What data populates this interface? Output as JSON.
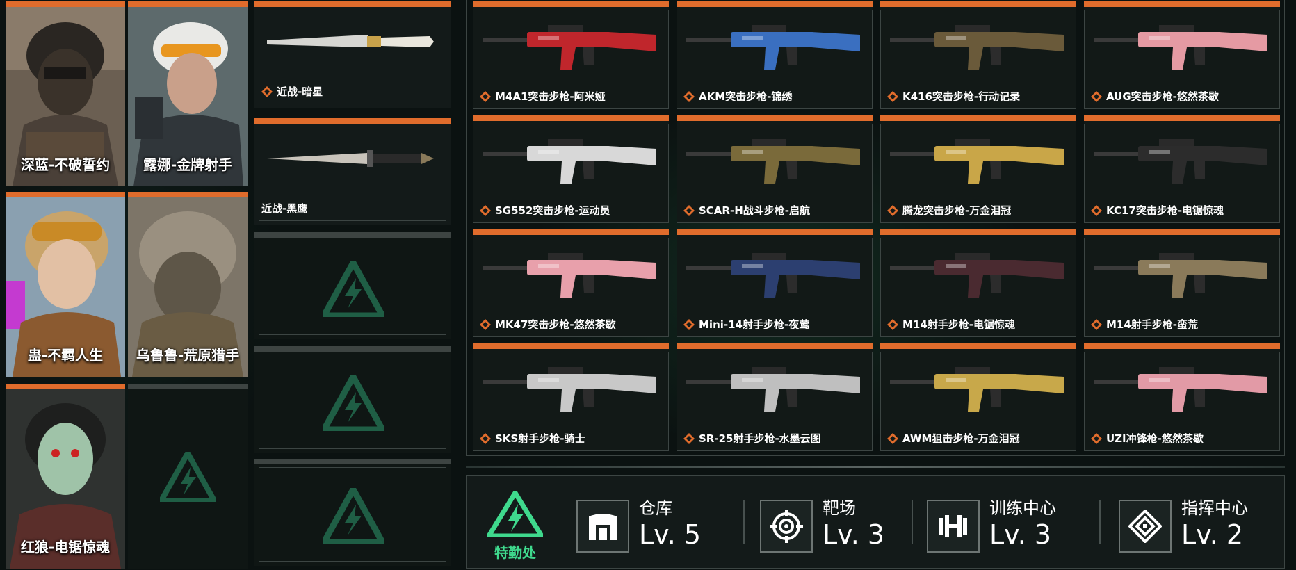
{
  "colors": {
    "accent_orange": "#e06c2c",
    "agency_green": "#3fd98d",
    "slot_empty_green": "#1f5e45"
  },
  "operators": [
    {
      "name": "深蓝-不破誓约",
      "empty": false,
      "icon": "operator-portrait-helmet"
    },
    {
      "name": "露娜-金牌射手",
      "empty": false,
      "icon": "operator-portrait-goggles-cap"
    },
    {
      "name": "蛊-不羁人生",
      "empty": false,
      "icon": "operator-portrait-goggles-blonde"
    },
    {
      "name": "乌鲁鲁-荒原猎手",
      "empty": false,
      "icon": "operator-portrait-ghillie"
    },
    {
      "name": "红狼-电锯惊魂",
      "empty": false,
      "icon": "operator-portrait-puppet-mask"
    },
    {
      "name": "",
      "empty": true,
      "icon": "empty-slot-logo-icon"
    }
  ],
  "melee": [
    {
      "label": "近战-暗星",
      "empty": false,
      "icon": "knife-icon"
    },
    {
      "label": "近战-黑鹰",
      "empty": false,
      "icon": "dagger-icon"
    },
    {
      "label": "",
      "empty": true
    },
    {
      "label": "",
      "empty": true
    },
    {
      "label": "",
      "empty": true
    }
  ],
  "weapons": [
    {
      "label": "M4A1突击步枪-阿米娅",
      "skin": "#c0262c"
    },
    {
      "label": "AKM突击步枪-锦绣",
      "skin": "#3a6fc0"
    },
    {
      "label": "K416突击步枪-行动记录",
      "skin": "#6a5a3a"
    },
    {
      "label": "AUG突击步枪-悠然茶歇",
      "skin": "#e59aa3"
    },
    {
      "label": "SG552突击步枪-运动员",
      "skin": "#d8d8d8"
    },
    {
      "label": "SCAR-H战斗步枪-启航",
      "skin": "#7a6a3a"
    },
    {
      "label": "腾龙突击步枪-万金泪冠",
      "skin": "#c9a648"
    },
    {
      "label": "KC17突击步枪-电锯惊魂",
      "skin": "#2c2c2c"
    },
    {
      "label": "MK47突击步枪-悠然茶歇",
      "skin": "#e8a0ab"
    },
    {
      "label": "Mini-14射手步枪-夜莺",
      "skin": "#2c3f70"
    },
    {
      "label": "M14射手步枪-电锯惊魂",
      "skin": "#4a2a30"
    },
    {
      "label": "M14射手步枪-蛮荒",
      "skin": "#8a7a5a"
    },
    {
      "label": "SKS射手步枪-骑士",
      "skin": "#c8c8c8"
    },
    {
      "label": "SR-25射手步枪-水墨云图",
      "skin": "#bfbfbf"
    },
    {
      "label": "AWM狙击步枪-万金泪冠",
      "skin": "#c8a84a"
    },
    {
      "label": "UZI冲锋枪-悠然茶歇",
      "skin": "#e29aa6"
    }
  ],
  "agency": {
    "label": "特勤处",
    "icon": "agency-lightning-logo"
  },
  "facilities": [
    {
      "name": "仓库",
      "level": "Lv. 5",
      "icon": "warehouse-icon"
    },
    {
      "name": "靶场",
      "level": "Lv. 3",
      "icon": "target-icon"
    },
    {
      "name": "训练中心",
      "level": "Lv. 3",
      "icon": "dumbbell-icon"
    },
    {
      "name": "指挥中心",
      "level": "Lv. 2",
      "icon": "command-center-icon"
    }
  ]
}
